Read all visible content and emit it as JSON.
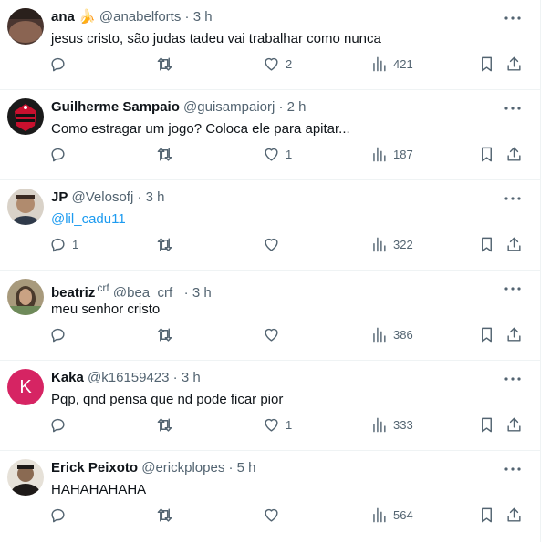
{
  "tweets": [
    {
      "name": "ana",
      "emoji": "🍌",
      "handle": "@anabelforts",
      "sep": "·",
      "time": "3 h",
      "text": "jesus cristo, são judas tadeu vai trabalhar como nunca",
      "is_mention": false,
      "replies": "",
      "likes": "2",
      "views": "421",
      "avatar_color": "#7a5a4a"
    },
    {
      "name": "Guilherme Sampaio",
      "handle": "@guisampaiorj",
      "sep": "·",
      "time": "2 h",
      "text": "Como estragar um jogo? Coloca ele para apitar...",
      "is_mention": false,
      "replies": "",
      "likes": "1",
      "views": "187",
      "avatar_color": "#c8102e"
    },
    {
      "name": "JP",
      "handle": "@Velosofj",
      "sep": "·",
      "time": "3 h",
      "text": "@lil_cadu11",
      "is_mention": true,
      "replies": "1",
      "likes": "",
      "views": "322",
      "avatar_color": "#b08b6e"
    },
    {
      "name": "beatriz",
      "flair": "crf",
      "handle": "@bea_crf_",
      "sep": "·",
      "time": "3 h",
      "text": "meu senhor cristo",
      "is_mention": false,
      "replies": "",
      "likes": "",
      "views": "386",
      "avatar_color": "#8a7a5e"
    },
    {
      "name": "Kaka",
      "handle": "@k16159423",
      "sep": "·",
      "time": "3 h",
      "text": "Pqp, qnd pensa que nd pode ficar pior",
      "is_mention": false,
      "replies": "",
      "likes": "1",
      "views": "333",
      "avatar_letter": "K",
      "avatar_color": "#d62463"
    },
    {
      "name": "Erick Peixoto",
      "handle": "@erickplopes",
      "sep": "·",
      "time": "5 h",
      "text": "HAHAHAHAHA",
      "is_mention": false,
      "replies": "",
      "likes": "",
      "views": "564",
      "avatar_color": "#5a4a3e"
    }
  ],
  "icons": {
    "more": "more-dots-icon",
    "reply": "reply-icon",
    "retweet": "retweet-icon",
    "like": "heart-icon",
    "views": "views-icon",
    "bookmark": "bookmark-icon",
    "share": "share-icon"
  },
  "colors": {
    "text": "#0f1419",
    "secondary": "#536471",
    "link": "#1d9bf0",
    "divider": "#eff3f4"
  }
}
